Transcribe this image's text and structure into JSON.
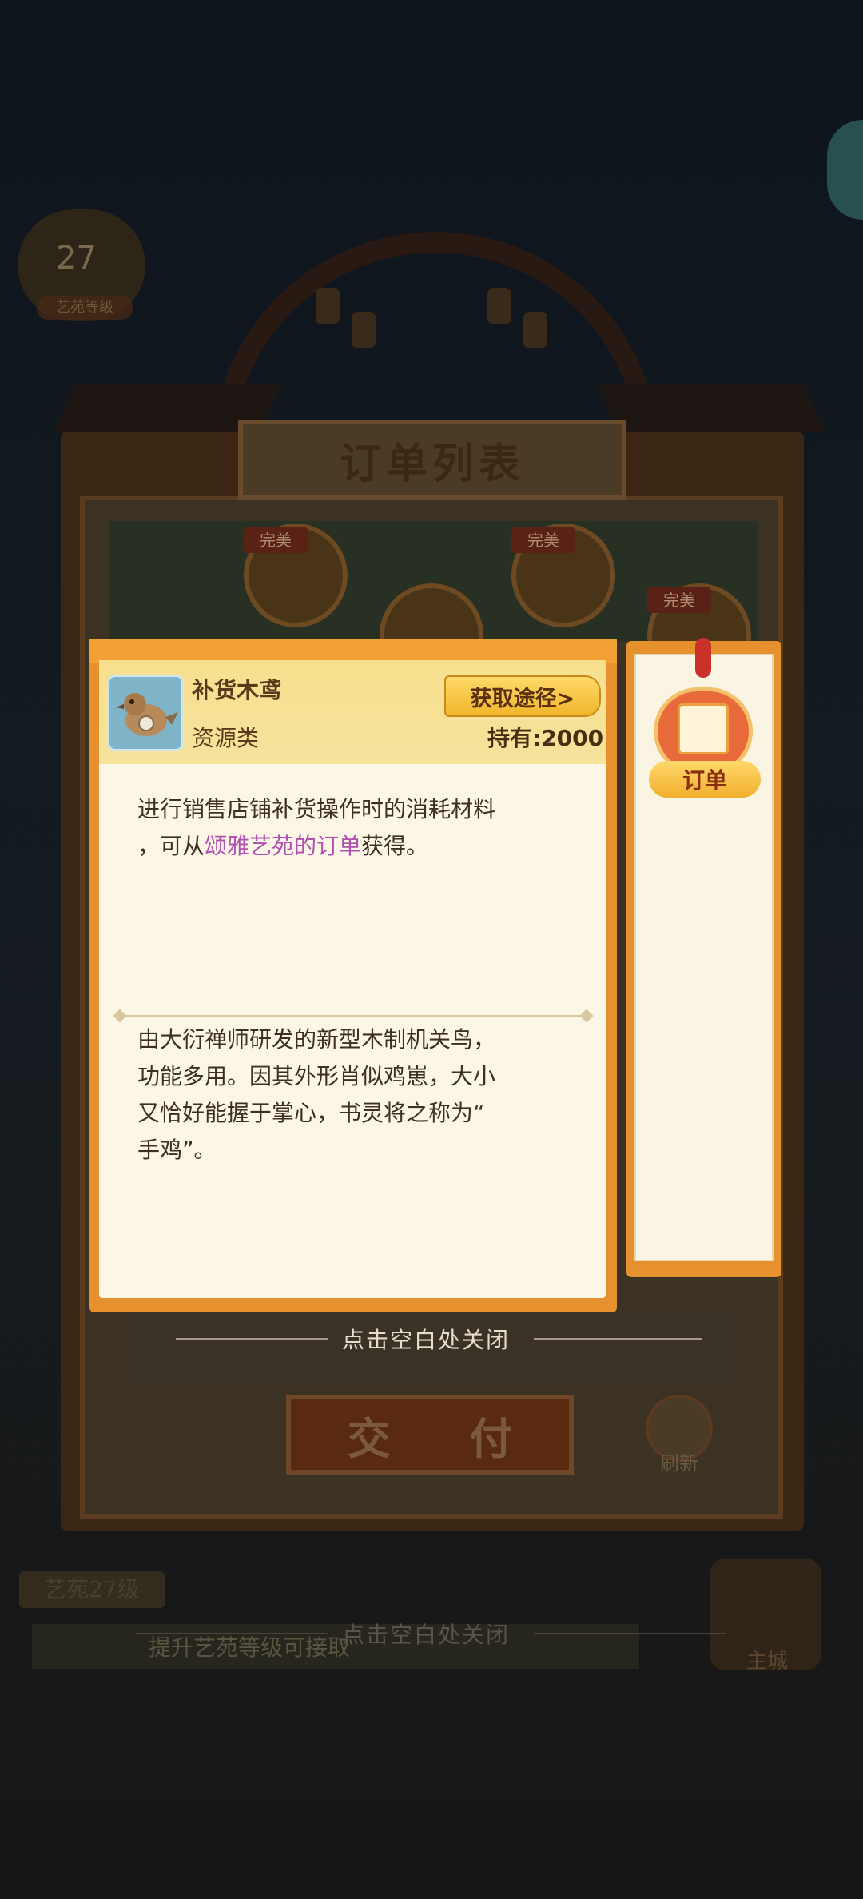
{
  "background": {
    "order_panel_title": "订单列表",
    "perfect_tags": [
      "完美",
      "完美",
      "完美"
    ],
    "deliver_button": "交 付",
    "refresh_label": "刷新",
    "level_number": "27",
    "level_caption": "艺苑等级",
    "yiyuan_level": "艺苑27级",
    "unlock_hint": "提升艺苑等级可接取",
    "main_city": "主城",
    "close_hint_lower": "点击空白处关闭"
  },
  "detail": {
    "item_name": "补货木鸢",
    "item_category": "资源类",
    "source_button": "获取途径>",
    "owned": "持有:2000",
    "desc_line1": "进行销售店铺补货操作时的消耗材料",
    "desc_line2_prefix": "，可从",
    "desc_line2_highlight": "颂雅艺苑的订单",
    "desc_line2_suffix": "获得。",
    "lore_lines": [
      "由大衍禅师研发的新型木制机关鸟，",
      "功能多用。因其外形肖似鸡崽，大小",
      "又恰好能握于掌心，书灵将之称为“",
      "手鸡”。"
    ],
    "close_hint": "点击空白处关闭"
  },
  "side_tab": {
    "label": "订单"
  },
  "colors": {
    "panel_orange": "#e6902e",
    "header_yellow": "#f7df8e",
    "highlight_purple": "#b050b0"
  }
}
